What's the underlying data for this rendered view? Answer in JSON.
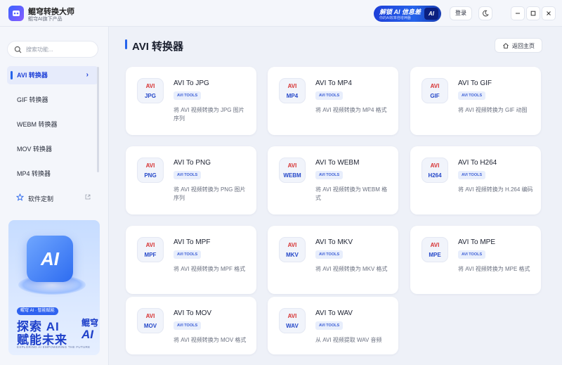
{
  "app": {
    "name": "鲲穹转换大师",
    "subtitle": "鲲穹AI旗下产品"
  },
  "header": {
    "promo_title": "解锁 AI 信息差",
    "promo_subtitle": "你的AI效率倍增神器",
    "promo_badge": "AI",
    "login_label": "登录"
  },
  "sidebar": {
    "search_placeholder": "搜索功能...",
    "items": [
      {
        "label": "AVI 转换器",
        "active": true
      },
      {
        "label": "GIF 转换器"
      },
      {
        "label": "WEBM 转换器"
      },
      {
        "label": "MOV 转换器"
      },
      {
        "label": "MP4 转换器"
      }
    ],
    "custom_label": "软件定制"
  },
  "banner": {
    "cube_text": "AI",
    "tag": "鲲穹 AI · 智能赋能",
    "line1": "探索 AI",
    "line2": "赋能未来",
    "brand": "鲲穹",
    "brand_ai": "AI",
    "english": "EXPLORING AI EMPOWERING THE FUTURE"
  },
  "main": {
    "title": "AVI 转换器",
    "back_label": "返回主页",
    "cards": [
      {
        "top": "AVI",
        "bottom": "JPG",
        "title": "AVI To JPG",
        "tag": "AVI TOOLS",
        "desc": "将 AVI 视频转换为 JPG 图片序列"
      },
      {
        "top": "AVI",
        "bottom": "MP4",
        "title": "AVI To MP4",
        "tag": "AVI TOOLS",
        "desc": "将 AVI 视频转换为 MP4 格式"
      },
      {
        "top": "AVI",
        "bottom": "GIF",
        "title": "AVI To GIF",
        "tag": "AVI TOOLS",
        "desc": "将 AVI 视频转换为 GIF 动图"
      },
      {
        "top": "AVI",
        "bottom": "PNG",
        "title": "AVI To PNG",
        "tag": "AVI TOOLS",
        "desc": "将 AVI 视频转换为 PNG 图片序列"
      },
      {
        "top": "AVI",
        "bottom": "WEBM",
        "title": "AVI To WEBM",
        "tag": "AVI TOOLS",
        "desc": "将 AVI 视频转换为 WEBM 格式"
      },
      {
        "top": "AVI",
        "bottom": "H264",
        "title": "AVI To H264",
        "tag": "AVI TOOLS",
        "desc": "将 AVI 视频转换为 H.264 编码"
      },
      {
        "top": "AVI",
        "bottom": "MPF",
        "title": "AVI To MPF",
        "tag": "AVI TOOLS",
        "desc": "将 AVI 视频转换为 MPF 格式"
      },
      {
        "top": "AVI",
        "bottom": "MKV",
        "title": "AVI To MKV",
        "tag": "AVI TOOLS",
        "desc": "将 AVI 视频转换为 MKV 格式"
      },
      {
        "top": "AVI",
        "bottom": "MPE",
        "title": "AVI To MPE",
        "tag": "AVI TOOLS",
        "desc": "将 AVI 视频转换为 MPE 格式"
      },
      {
        "top": "AVI",
        "bottom": "MOV",
        "title": "AVI To MOV",
        "tag": "AVI TOOLS",
        "desc": "将 AVI 视频转换为 MOV 格式"
      },
      {
        "top": "AVI",
        "bottom": "WAV",
        "title": "AVI To WAV",
        "tag": "AVI TOOLS",
        "desc": "从 AVI 视频提取 WAV 音频"
      }
    ]
  },
  "colors": {
    "accent": "#2563eb",
    "icon_top": "#d63030",
    "icon_bottom": "#2548c9",
    "tag_bg": "#e8eefc"
  }
}
